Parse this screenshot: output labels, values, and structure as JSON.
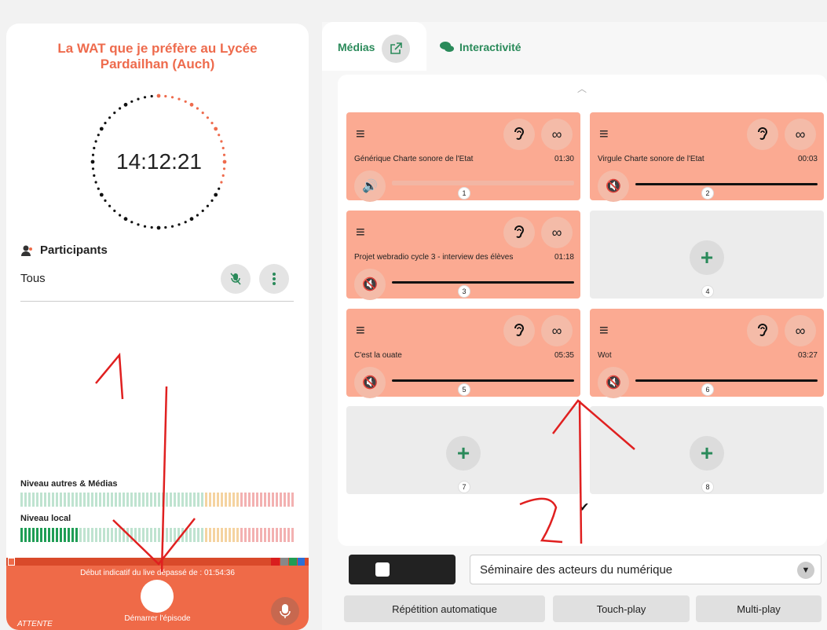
{
  "left": {
    "title": "La WAT que je préfère au Lycée Pardailhan (Auch)",
    "clock_time": "14:12:21",
    "participants_label": "Participants",
    "participant_filter": "Tous",
    "level_others_label": "Niveau autres & Médias",
    "level_local_label": "Niveau local",
    "overtime_text": "Début indicatif du live dépassé de : 01:54:36",
    "start_label": "Démarrer l'épisode",
    "status": "ATTENTE"
  },
  "tabs": [
    {
      "label": "Médias"
    },
    {
      "label": "Interactivité"
    }
  ],
  "cards": [
    {
      "n": "1",
      "title": "Générique Charte sonore de l'Etat",
      "dur": "01:30"
    },
    {
      "n": "2",
      "title": "Virgule Charte sonore de l'Etat",
      "dur": "00:03"
    },
    {
      "n": "3",
      "title": "Projet webradio cycle 3 - interview des élèves",
      "dur": "01:18"
    },
    {
      "n": "4"
    },
    {
      "n": "5",
      "title": "C'est la ouate",
      "dur": "05:35"
    },
    {
      "n": "6",
      "title": "Wot",
      "dur": "03:27"
    },
    {
      "n": "7"
    },
    {
      "n": "8"
    }
  ],
  "select_value": "Séminaire des acteurs du numérique",
  "modes": [
    "Répétition automatique",
    "Touch-play",
    "Multi-play"
  ],
  "icons": {
    "ear": "ear-icon",
    "loop": "infinity-icon",
    "menu": "hamburger-icon",
    "volume": "speaker-icon",
    "muted": "speaker-muted-icon",
    "plus": "plus-icon"
  }
}
